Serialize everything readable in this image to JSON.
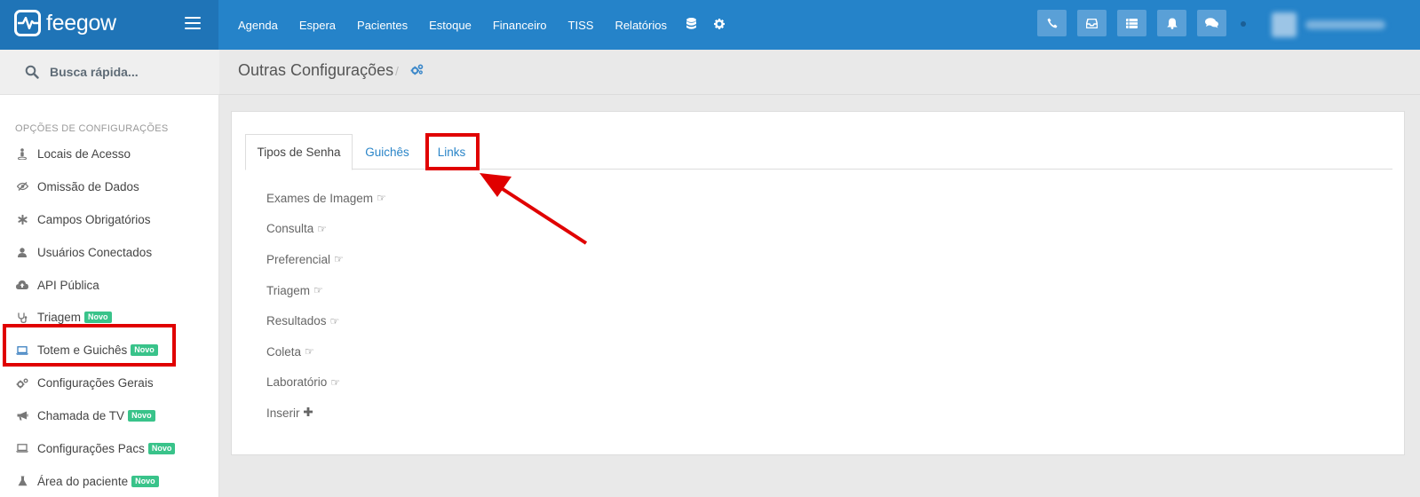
{
  "brand": {
    "name": "feegow"
  },
  "nav": {
    "items": [
      "Agenda",
      "Espera",
      "Pacientes",
      "Estoque",
      "Financeiro",
      "TISS",
      "Relatórios"
    ],
    "icons": [
      "database-icon",
      "gear-icon"
    ]
  },
  "topbar_buttons": [
    "phone-icon",
    "inbox-icon",
    "list-icon",
    "bell-icon",
    "chat-icon"
  ],
  "search": {
    "placeholder": "Busca rápida..."
  },
  "sidebar": {
    "heading": "OPÇÕES DE CONFIGURAÇÕES",
    "items": [
      {
        "label": "Locais de Acesso",
        "icon": "street-view-icon",
        "badge": ""
      },
      {
        "label": "Omissão de Dados",
        "icon": "eye-slash-icon",
        "badge": ""
      },
      {
        "label": "Campos Obrigatórios",
        "icon": "asterisk-icon",
        "badge": ""
      },
      {
        "label": "Usuários Conectados",
        "icon": "user-icon",
        "badge": ""
      },
      {
        "label": "API Pública",
        "icon": "cloud-upload-icon",
        "badge": ""
      },
      {
        "label": "Triagem",
        "icon": "stethoscope-icon",
        "badge": "Novo"
      },
      {
        "label": "Totem e Guichês",
        "icon": "laptop-icon",
        "badge": "Novo"
      },
      {
        "label": "Configurações Gerais",
        "icon": "gears-icon",
        "badge": ""
      },
      {
        "label": "Chamada de TV",
        "icon": "bullhorn-icon",
        "badge": "Novo"
      },
      {
        "label": "Configurações Pacs",
        "icon": "laptop-icon",
        "badge": "Novo"
      },
      {
        "label": "Área do paciente",
        "icon": "flask-icon",
        "badge": "Novo"
      }
    ]
  },
  "page": {
    "title": "Outras Configurações",
    "separator": "/"
  },
  "tabs": [
    "Tipos de Senha",
    "Guichês",
    "Links"
  ],
  "active_tab": "Tipos de Senha",
  "types": [
    "Exames de Imagem",
    "Consulta",
    "Preferencial",
    "Triagem",
    "Resultados",
    "Coleta",
    "Laboratório"
  ],
  "insert_label": "Inserir",
  "colors": {
    "topbar": "#2583c9",
    "brand": "#1f74b7",
    "badge": "#39c38a",
    "highlight": "#e00000",
    "link": "#2a85c8"
  }
}
